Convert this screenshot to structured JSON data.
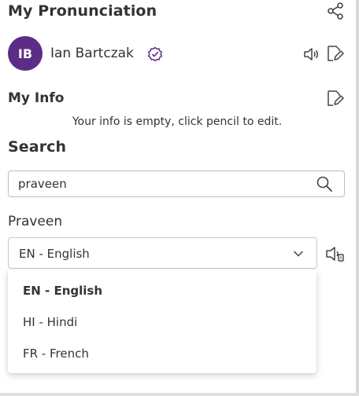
{
  "header": {
    "title": "My Pronunciation",
    "share_icon": "share-icon"
  },
  "user": {
    "initials": "IB",
    "name": "Ian Bartczak",
    "avatar_color": "#5b2d86",
    "verified_color": "#5b2d86"
  },
  "my_info": {
    "title": "My Info",
    "empty_text": "Your info is empty, click pencil to edit."
  },
  "search": {
    "title": "Search",
    "value": "praveen"
  },
  "result": {
    "name": "Praveen",
    "selected_language": "EN - English",
    "options": [
      {
        "label": "EN - English",
        "selected": true
      },
      {
        "label": "HI - Hindi",
        "selected": false
      },
      {
        "label": "FR - French",
        "selected": false
      }
    ]
  }
}
